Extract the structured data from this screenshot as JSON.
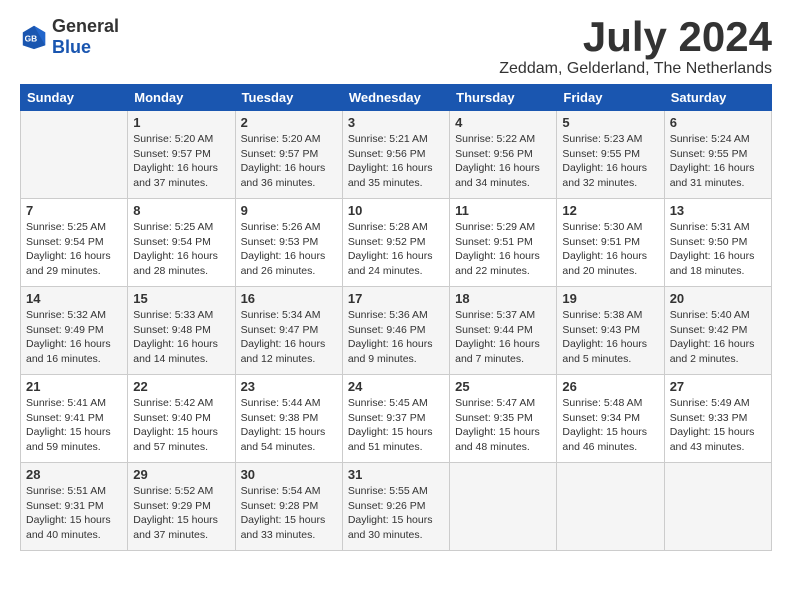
{
  "header": {
    "logo_general": "General",
    "logo_blue": "Blue",
    "month_year": "July 2024",
    "location": "Zeddam, Gelderland, The Netherlands"
  },
  "days_of_week": [
    "Sunday",
    "Monday",
    "Tuesday",
    "Wednesday",
    "Thursday",
    "Friday",
    "Saturday"
  ],
  "weeks": [
    [
      {
        "day": "",
        "sunrise": "",
        "sunset": "",
        "daylight": ""
      },
      {
        "day": "1",
        "sunrise": "Sunrise: 5:20 AM",
        "sunset": "Sunset: 9:57 PM",
        "daylight": "Daylight: 16 hours and 37 minutes."
      },
      {
        "day": "2",
        "sunrise": "Sunrise: 5:20 AM",
        "sunset": "Sunset: 9:57 PM",
        "daylight": "Daylight: 16 hours and 36 minutes."
      },
      {
        "day": "3",
        "sunrise": "Sunrise: 5:21 AM",
        "sunset": "Sunset: 9:56 PM",
        "daylight": "Daylight: 16 hours and 35 minutes."
      },
      {
        "day": "4",
        "sunrise": "Sunrise: 5:22 AM",
        "sunset": "Sunset: 9:56 PM",
        "daylight": "Daylight: 16 hours and 34 minutes."
      },
      {
        "day": "5",
        "sunrise": "Sunrise: 5:23 AM",
        "sunset": "Sunset: 9:55 PM",
        "daylight": "Daylight: 16 hours and 32 minutes."
      },
      {
        "day": "6",
        "sunrise": "Sunrise: 5:24 AM",
        "sunset": "Sunset: 9:55 PM",
        "daylight": "Daylight: 16 hours and 31 minutes."
      }
    ],
    [
      {
        "day": "7",
        "sunrise": "Sunrise: 5:25 AM",
        "sunset": "Sunset: 9:54 PM",
        "daylight": "Daylight: 16 hours and 29 minutes."
      },
      {
        "day": "8",
        "sunrise": "Sunrise: 5:25 AM",
        "sunset": "Sunset: 9:54 PM",
        "daylight": "Daylight: 16 hours and 28 minutes."
      },
      {
        "day": "9",
        "sunrise": "Sunrise: 5:26 AM",
        "sunset": "Sunset: 9:53 PM",
        "daylight": "Daylight: 16 hours and 26 minutes."
      },
      {
        "day": "10",
        "sunrise": "Sunrise: 5:28 AM",
        "sunset": "Sunset: 9:52 PM",
        "daylight": "Daylight: 16 hours and 24 minutes."
      },
      {
        "day": "11",
        "sunrise": "Sunrise: 5:29 AM",
        "sunset": "Sunset: 9:51 PM",
        "daylight": "Daylight: 16 hours and 22 minutes."
      },
      {
        "day": "12",
        "sunrise": "Sunrise: 5:30 AM",
        "sunset": "Sunset: 9:51 PM",
        "daylight": "Daylight: 16 hours and 20 minutes."
      },
      {
        "day": "13",
        "sunrise": "Sunrise: 5:31 AM",
        "sunset": "Sunset: 9:50 PM",
        "daylight": "Daylight: 16 hours and 18 minutes."
      }
    ],
    [
      {
        "day": "14",
        "sunrise": "Sunrise: 5:32 AM",
        "sunset": "Sunset: 9:49 PM",
        "daylight": "Daylight: 16 hours and 16 minutes."
      },
      {
        "day": "15",
        "sunrise": "Sunrise: 5:33 AM",
        "sunset": "Sunset: 9:48 PM",
        "daylight": "Daylight: 16 hours and 14 minutes."
      },
      {
        "day": "16",
        "sunrise": "Sunrise: 5:34 AM",
        "sunset": "Sunset: 9:47 PM",
        "daylight": "Daylight: 16 hours and 12 minutes."
      },
      {
        "day": "17",
        "sunrise": "Sunrise: 5:36 AM",
        "sunset": "Sunset: 9:46 PM",
        "daylight": "Daylight: 16 hours and 9 minutes."
      },
      {
        "day": "18",
        "sunrise": "Sunrise: 5:37 AM",
        "sunset": "Sunset: 9:44 PM",
        "daylight": "Daylight: 16 hours and 7 minutes."
      },
      {
        "day": "19",
        "sunrise": "Sunrise: 5:38 AM",
        "sunset": "Sunset: 9:43 PM",
        "daylight": "Daylight: 16 hours and 5 minutes."
      },
      {
        "day": "20",
        "sunrise": "Sunrise: 5:40 AM",
        "sunset": "Sunset: 9:42 PM",
        "daylight": "Daylight: 16 hours and 2 minutes."
      }
    ],
    [
      {
        "day": "21",
        "sunrise": "Sunrise: 5:41 AM",
        "sunset": "Sunset: 9:41 PM",
        "daylight": "Daylight: 15 hours and 59 minutes."
      },
      {
        "day": "22",
        "sunrise": "Sunrise: 5:42 AM",
        "sunset": "Sunset: 9:40 PM",
        "daylight": "Daylight: 15 hours and 57 minutes."
      },
      {
        "day": "23",
        "sunrise": "Sunrise: 5:44 AM",
        "sunset": "Sunset: 9:38 PM",
        "daylight": "Daylight: 15 hours and 54 minutes."
      },
      {
        "day": "24",
        "sunrise": "Sunrise: 5:45 AM",
        "sunset": "Sunset: 9:37 PM",
        "daylight": "Daylight: 15 hours and 51 minutes."
      },
      {
        "day": "25",
        "sunrise": "Sunrise: 5:47 AM",
        "sunset": "Sunset: 9:35 PM",
        "daylight": "Daylight: 15 hours and 48 minutes."
      },
      {
        "day": "26",
        "sunrise": "Sunrise: 5:48 AM",
        "sunset": "Sunset: 9:34 PM",
        "daylight": "Daylight: 15 hours and 46 minutes."
      },
      {
        "day": "27",
        "sunrise": "Sunrise: 5:49 AM",
        "sunset": "Sunset: 9:33 PM",
        "daylight": "Daylight: 15 hours and 43 minutes."
      }
    ],
    [
      {
        "day": "28",
        "sunrise": "Sunrise: 5:51 AM",
        "sunset": "Sunset: 9:31 PM",
        "daylight": "Daylight: 15 hours and 40 minutes."
      },
      {
        "day": "29",
        "sunrise": "Sunrise: 5:52 AM",
        "sunset": "Sunset: 9:29 PM",
        "daylight": "Daylight: 15 hours and 37 minutes."
      },
      {
        "day": "30",
        "sunrise": "Sunrise: 5:54 AM",
        "sunset": "Sunset: 9:28 PM",
        "daylight": "Daylight: 15 hours and 33 minutes."
      },
      {
        "day": "31",
        "sunrise": "Sunrise: 5:55 AM",
        "sunset": "Sunset: 9:26 PM",
        "daylight": "Daylight: 15 hours and 30 minutes."
      },
      {
        "day": "",
        "sunrise": "",
        "sunset": "",
        "daylight": ""
      },
      {
        "day": "",
        "sunrise": "",
        "sunset": "",
        "daylight": ""
      },
      {
        "day": "",
        "sunrise": "",
        "sunset": "",
        "daylight": ""
      }
    ]
  ]
}
